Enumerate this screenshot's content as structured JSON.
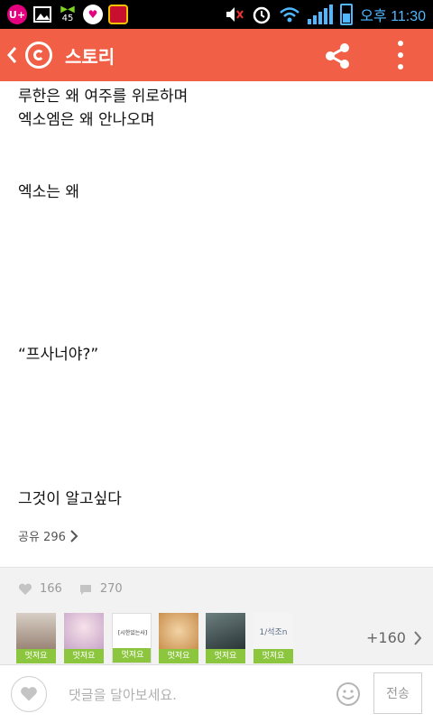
{
  "status_bar": {
    "time": "오후 11:30",
    "notification_badge": "45",
    "icons": [
      "uplus-icon",
      "image-icon",
      "download-icon",
      "hello-kitty-icon",
      "game-icon",
      "volume-muted-icon",
      "alarm-icon",
      "wifi-icon",
      "signal-icon",
      "battery-icon"
    ]
  },
  "app_bar": {
    "title": "스토리",
    "accent_color": "#f16046"
  },
  "story": {
    "lines": [
      "루한은 왜 여주를 위로하며",
      "엑소엠은 왜 안나오며",
      "엑소는 왜",
      "“프사너야?”",
      "그것이 알고싶다"
    ],
    "share_label": "공유 296"
  },
  "stats": {
    "likes": "166",
    "comments": "270",
    "likers": [
      {
        "tag": "멋져요",
        "color": "#c9b8a8"
      },
      {
        "tag": "멋져요",
        "color": "#e7c7d8"
      },
      {
        "tag": "멋져요",
        "color": "#ffffff",
        "text": "[시한있는사]"
      },
      {
        "tag": "멋져요",
        "color": "#d9a46a"
      },
      {
        "tag": "멋져요",
        "color": "#4a5a5c"
      },
      {
        "tag": "멋져요",
        "color": "#f4f4f4",
        "text": "1/석조n"
      }
    ],
    "more_likers": "+160",
    "tag_color": "#8cc63f"
  },
  "comment_bar": {
    "placeholder": "댓글을 달아보세요.",
    "send_label": "전송"
  }
}
